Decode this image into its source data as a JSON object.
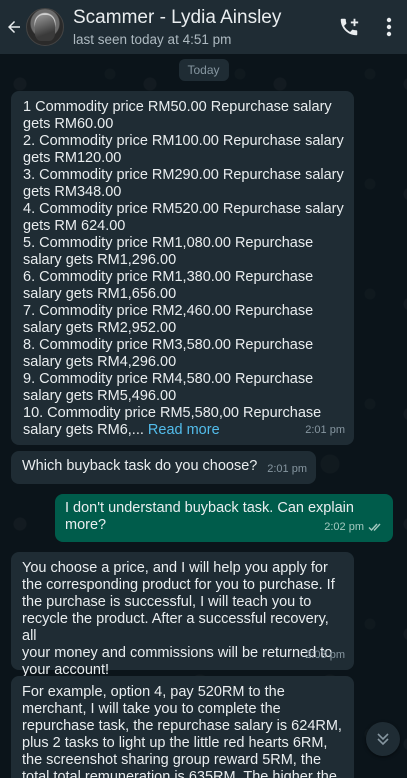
{
  "header": {
    "title": "Scammer - Lydia Ainsley",
    "subtitle": "last seen today at 4:51 pm"
  },
  "date_chip": "Today",
  "messages": [
    {
      "direction": "incoming",
      "lines": [
        "1  Commodity price RM50.00  Repurchase salary",
        "gets RM60.00",
        "2. Commodity price RM100.00  Repurchase salary",
        "gets RM120.00",
        "3. Commodity price RM290.00  Repurchase salary",
        "gets RM348.00",
        "4. Commodity price RM520.00  Repurchase salary",
        "gets RM 624.00",
        "5. Commodity price RM1,080.00  Repurchase",
        "salary gets RM1,296.00",
        "6. Commodity price RM1,380.00  Repurchase",
        "salary gets RM1,656.00",
        "7. Commodity price RM2,460.00  Repurchase",
        "salary gets RM2,952.00",
        "8. Commodity price RM3,580.00  Repurchase",
        "salary gets RM4,296.00",
        "9. Commodity price RM4,580.00 Repurchase",
        "salary gets RM5,496.00",
        "10. Commodity price RM5,580,00 Repurchase"
      ],
      "last_line": "salary gets RM6,...",
      "read_more": "Read more",
      "time": "2:01 pm"
    },
    {
      "direction": "incoming",
      "text": "Which buyback task do you choose?",
      "time": "2:01 pm"
    },
    {
      "direction": "outgoing",
      "lines": [
        "I don't understand buyback task. Can explain",
        "more?"
      ],
      "time": "2:02 pm"
    },
    {
      "direction": "incoming",
      "lines": [
        "You choose a price, and I will help you apply for",
        "the corresponding product for you to purchase. If",
        "the purchase is successful, I will teach you to",
        "recycle the product. After a successful recovery, all",
        "your money and commissions will be returned to",
        "your account!"
      ],
      "time": "2:03 pm"
    },
    {
      "direction": "incoming",
      "lines": [
        "For example, option 4, pay 520RM to the",
        "merchant, I will take you to complete the",
        "repurchase task, the repurchase salary is 624RM,",
        "plus 2 tasks to light up the little red hearts 6RM,",
        "the screenshot sharing group reward 5RM, the",
        "total total remuneration is 635RM. The higher the"
      ]
    }
  ],
  "colors": {
    "background": "#0b141a",
    "header": "#1f2c34",
    "incoming_bubble": "#1f2c34",
    "outgoing_bubble": "#005c4b",
    "link": "#53bdeb",
    "read_ticks": "#a3c9bf"
  },
  "icons": [
    "back-arrow-icon",
    "avatar",
    "add-call-icon",
    "more-options-icon",
    "double-check-icon",
    "scroll-down-icon"
  ]
}
